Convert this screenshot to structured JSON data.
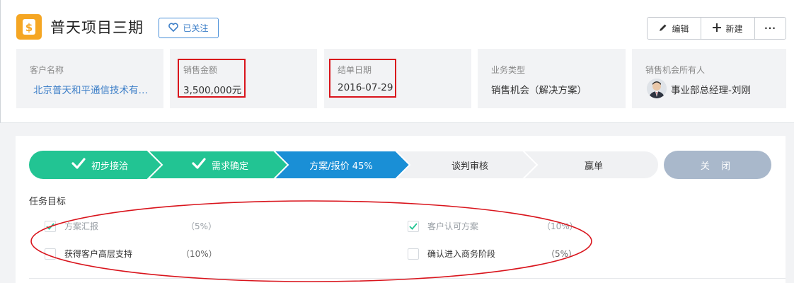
{
  "header": {
    "title": "普天项目三期",
    "follow_label": "已关注",
    "edit_label": "编辑",
    "new_label": "新建",
    "more_label": "···"
  },
  "fields": [
    {
      "label": "客户名称",
      "value": "北京普天和平通信技术有…"
    },
    {
      "label": "销售金额",
      "value": "3,500,000元"
    },
    {
      "label": "结单日期",
      "value": "2016-07-29"
    },
    {
      "label": "业务类型",
      "value": "销售机会（解决方案）"
    },
    {
      "label": "销售机会所有人",
      "value": "事业部总经理-刘刚"
    }
  ],
  "stages": [
    {
      "label": "初步接洽",
      "state": "done"
    },
    {
      "label": "需求确定",
      "state": "done"
    },
    {
      "label": "方案/报价 45%",
      "state": "current"
    },
    {
      "label": "谈判审核",
      "state": "todo"
    },
    {
      "label": "赢单",
      "state": "todo"
    }
  ],
  "close_label": "关 闭",
  "task_section_title": "任务目标",
  "tasks": [
    {
      "label": "方案汇报",
      "pct": "（5%）",
      "checked": true
    },
    {
      "label": "客户认可方案",
      "pct": "（10%）",
      "checked": true
    },
    {
      "label": "获得客户高层支持",
      "pct": "（10%）",
      "checked": false
    },
    {
      "label": "确认进入商务阶段",
      "pct": "（5%）",
      "checked": false
    }
  ],
  "colors": {
    "accent": "#f5a623",
    "done": "#22c493",
    "current": "#1a8fd6",
    "todo": "#f0f1f3",
    "close": "#a9b8cb",
    "annotation": "#d9141c"
  }
}
